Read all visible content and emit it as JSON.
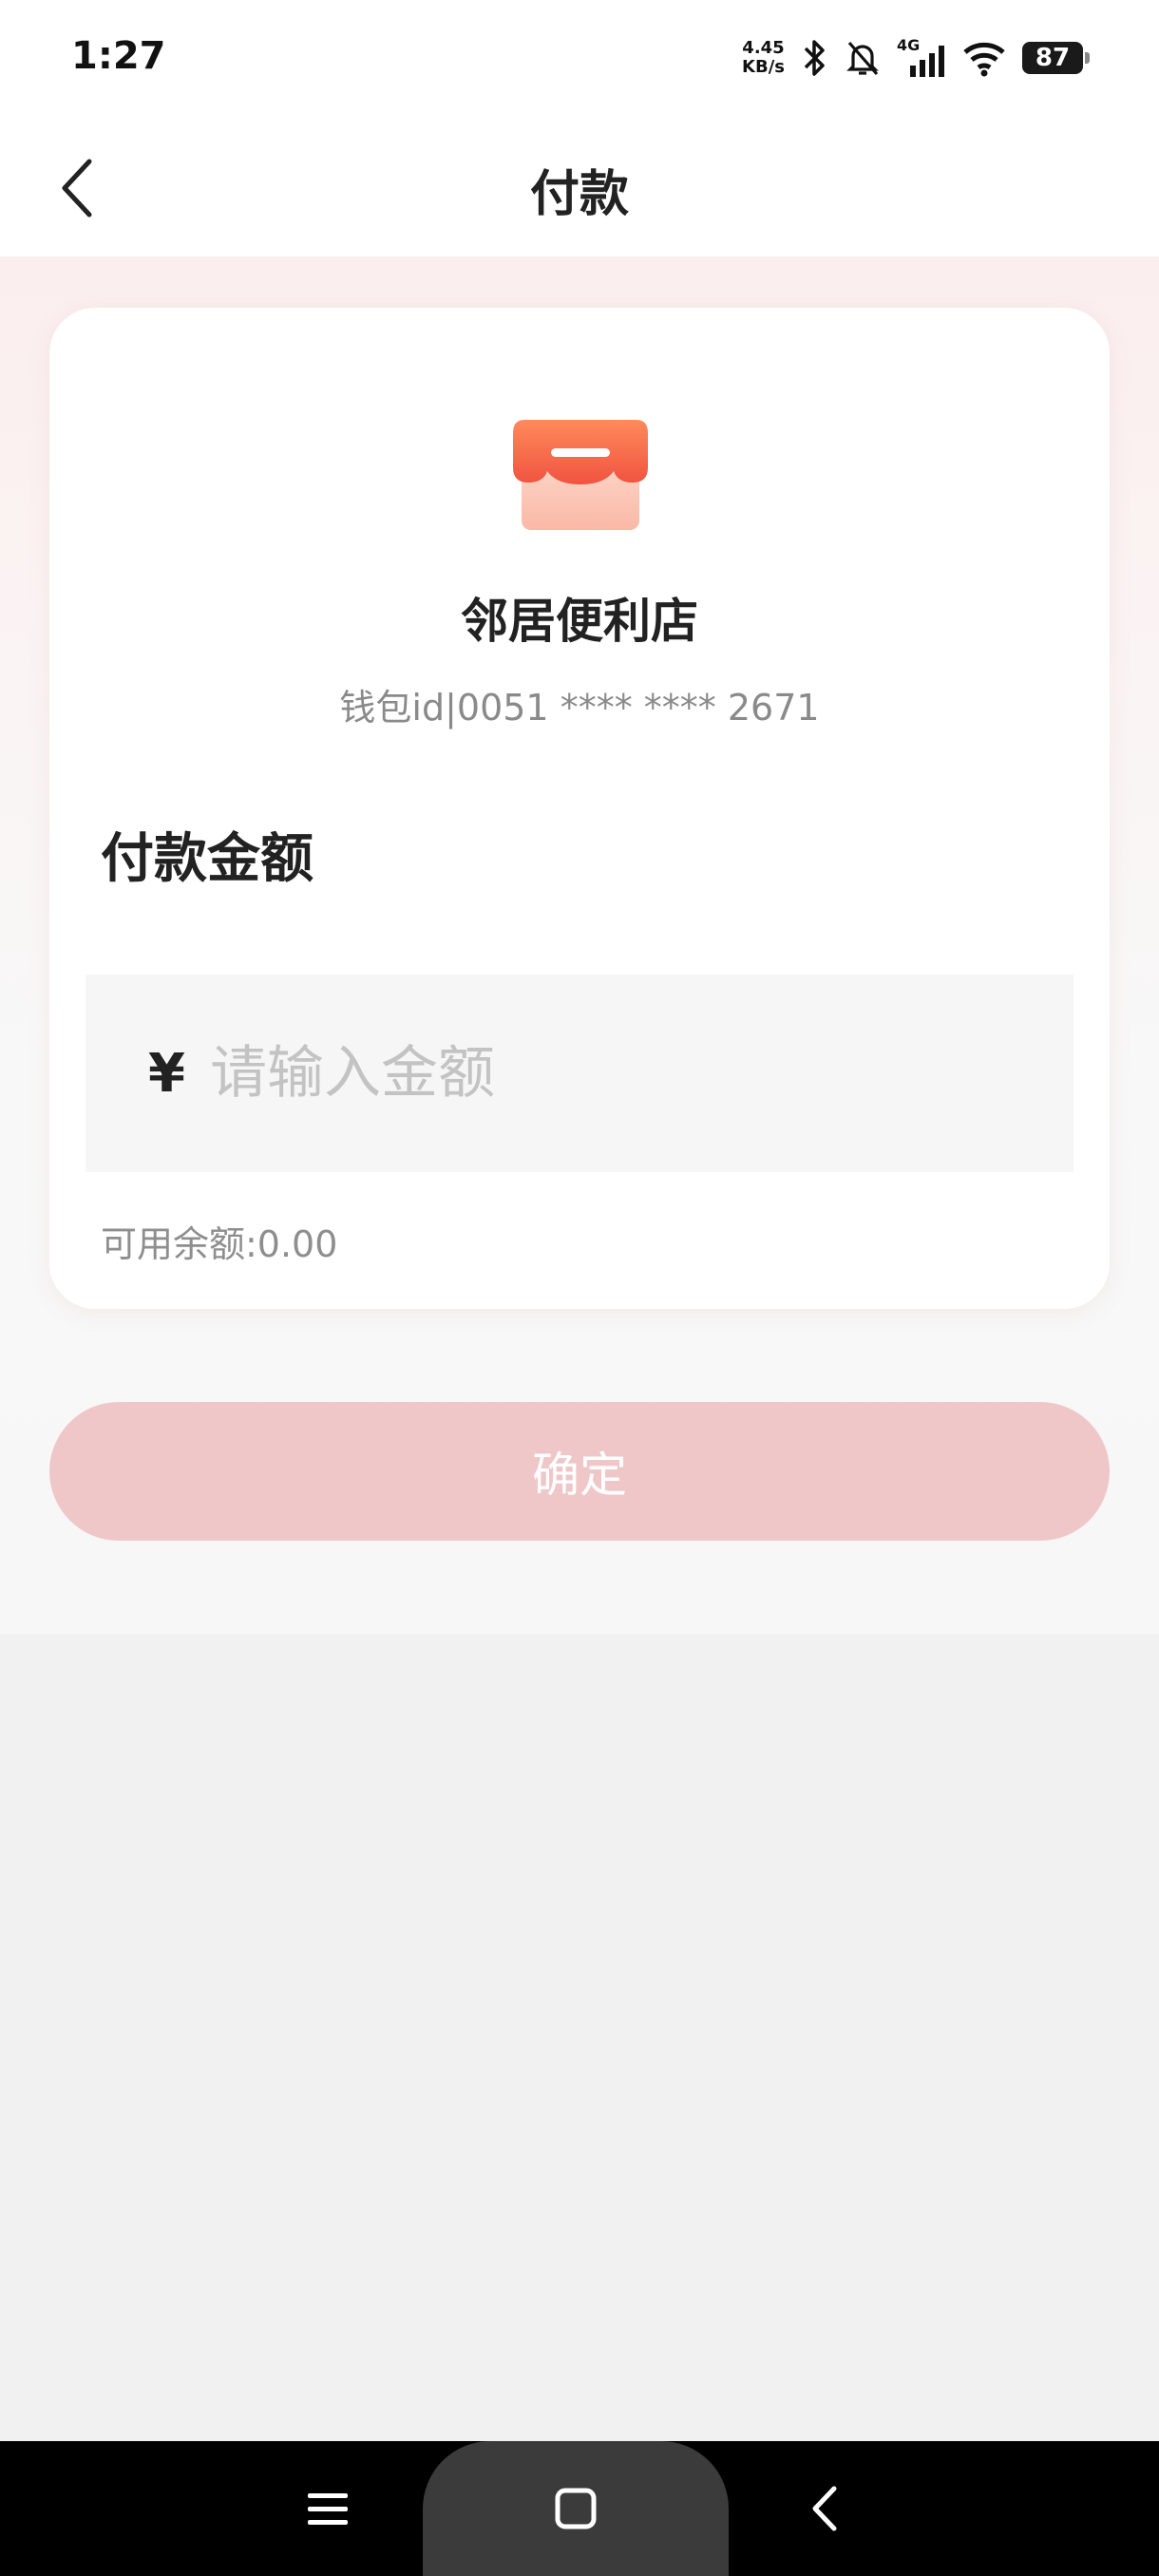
{
  "status_bar": {
    "time": "1:27",
    "net_speed_value": "4.45",
    "net_speed_unit": "KB/s",
    "network_type": "4G",
    "battery": "87",
    "icons": [
      "bluetooth-icon",
      "bell-muted-icon",
      "signal-icon",
      "wifi-icon",
      "battery-icon"
    ]
  },
  "header": {
    "title": "付款",
    "back_icon": "chevron-left-icon"
  },
  "merchant": {
    "name": "邻居便利店",
    "wallet_id": "钱包id|0051 **** **** 2671",
    "logo_icon": "store-icon",
    "logo_color": "#f26b4f"
  },
  "payment": {
    "amount_label": "付款金额",
    "currency_symbol": "¥",
    "amount_placeholder": "请输入金额",
    "amount_value": "",
    "balance_text": "可用余额:0.00"
  },
  "actions": {
    "confirm_label": "确定",
    "confirm_color": "#f0c7c8"
  },
  "nav_bar": {
    "icons": [
      "menu-icon",
      "home-icon",
      "back-icon"
    ]
  }
}
